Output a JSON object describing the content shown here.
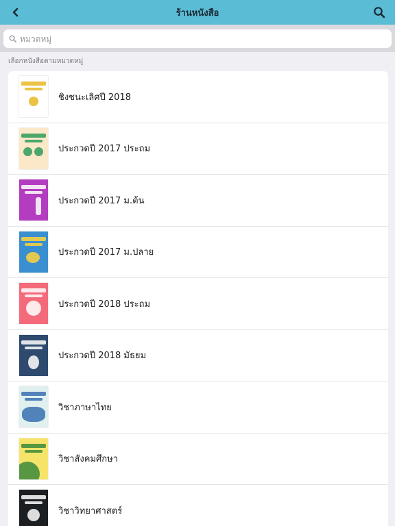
{
  "header": {
    "title": "ร้านหนังสือ",
    "back_icon": "chevron-left-icon",
    "search_icon": "search-icon"
  },
  "search": {
    "placeholder": "หมวดหมู่",
    "value": ""
  },
  "section": {
    "header": "เลือกหนังสือตามหมวดหมู่"
  },
  "categories": [
    {
      "label": "ชิงชนะเลิศปี 2018",
      "cover_bg": "#ffffff",
      "cover_accent": "#e8b923"
    },
    {
      "label": "ประกวดปี 2017 ประถม",
      "cover_bg": "#fbe8c8",
      "cover_accent": "#2e9a5a"
    },
    {
      "label": "ประกวดปี 2017 ม.ต้น",
      "cover_bg": "#b43cc0",
      "cover_accent": "#ffffff"
    },
    {
      "label": "ประกวดปี 2017 ม.ปลาย",
      "cover_bg": "#3a8fd0",
      "cover_accent": "#ffd23a"
    },
    {
      "label": "ประกวดปี 2018 ประถม",
      "cover_bg": "#f46a7a",
      "cover_accent": "#ffffff"
    },
    {
      "label": "ประกวดปี 2018 มัธยม",
      "cover_bg": "#2e4a6e",
      "cover_accent": "#ffffff"
    },
    {
      "label": "วิชาภาษาไทย",
      "cover_bg": "#dff0ee",
      "cover_accent": "#3a6fb0"
    },
    {
      "label": "วิชาสังคมศึกษา",
      "cover_bg": "#f6e46a",
      "cover_accent": "#3b8a3a"
    },
    {
      "label": "วิชาวิทยาศาสตร์",
      "cover_bg": "#1b1f22",
      "cover_accent": "#ffffff"
    }
  ],
  "colors": {
    "navbar": "#5bbcd6",
    "background": "#efeff4"
  }
}
